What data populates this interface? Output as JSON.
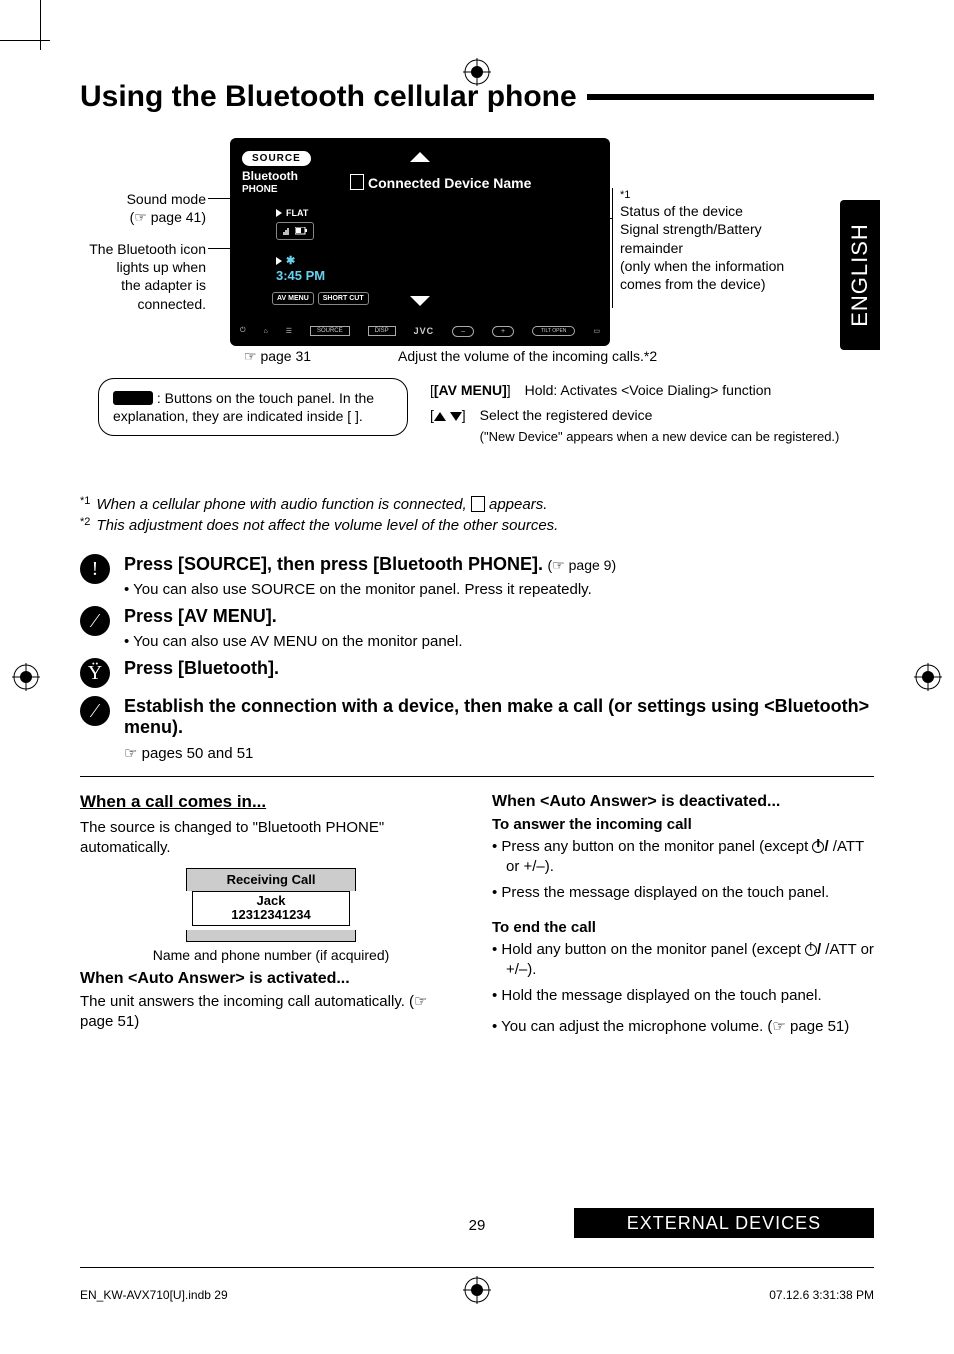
{
  "language_tab": "ENGLISH",
  "title": "Using the Bluetooth cellular phone",
  "device": {
    "source_pill": "SOURCE",
    "bt_line1": "Bluetooth",
    "bt_line2": "PHONE",
    "connected_label": "Connected Device Name",
    "flat": "FLAT",
    "bt_symbol": "✱",
    "time": "3:45 PM",
    "btn_av": "AV MENU",
    "btn_short": "SHORT CUT",
    "jvc": "JVC",
    "vol_minus": "–",
    "vol_plus": "+",
    "source_small": "SOURCE",
    "disp_small": "DISP",
    "tilt_small": "TILT OPEN"
  },
  "callouts": {
    "left1": "Sound mode",
    "left1b": "(☞ page 41)",
    "left2a": "The Bluetooth icon",
    "left2b": "lights up when",
    "left2c": "the adapter is",
    "left2d": "connected.",
    "right_star": "*1",
    "right1a": "Status of the device",
    "right1b": "Signal strength/Battery",
    "right1c": "remainder",
    "right1d": "(only when the information",
    "right1e": "comes from the device)",
    "mid_ref": "☞ page 31",
    "mid_adjust": "Adjust the volume of the incoming calls.*2"
  },
  "note_box_left": {
    "line1": ": Buttons on the touch panel. In the explanation, they are indicated inside [    ]."
  },
  "right_fn": {
    "k1": "[AV MENU]",
    "v1": "Hold: Activates <Voice Dialing> function",
    "v2": "Select the registered device",
    "v3": "(\"New Device\" appears when a new device can be registered.)"
  },
  "footnotes": {
    "f1_sup": "*1",
    "f1": "When a cellular phone with audio function is connected, ",
    "f1b": " appears.",
    "f2_sup": "*2",
    "f2": "This adjustment does not affect the volume level of the other sources."
  },
  "steps": {
    "s1_head": "Press [SOURCE], then press [Bluetooth PHONE].",
    "s1_ref": " (☞ page 9)",
    "s1_sub": "You can also use SOURCE on the monitor panel. Press it repeatedly.",
    "s2_head": "Press [AV MENU].",
    "s2_sub": "You can also use AV MENU on the monitor panel.",
    "s3_head": "Press [Bluetooth].",
    "s4_head": "Establish the connection with a device, then make a call (or settings using <Bluetooth> menu).",
    "s4_note": "☞ pages 50 and 51"
  },
  "left_col": {
    "h1": "When a call comes in...",
    "p1": "The source is changed to \"Bluetooth PHONE\" automatically.",
    "recv_title": "Receiving Call",
    "recv_name": "Jack",
    "recv_num": "12312341234",
    "recv_cap": "Name and phone number (if acquired)",
    "h2": "When <Auto Answer> is activated...",
    "p2a": "The unit answers the incoming call automatically.",
    "p2b": "(☞ page 51)"
  },
  "right_col": {
    "h1": "When <Auto Answer> is deactivated...",
    "h2": "To answer the incoming call",
    "li1a": "Press any button on the monitor panel (except ",
    "li1b": " /ATT or +/–).",
    "li2": "Press the message displayed on the touch panel.",
    "h3": "To end the call",
    "li3a": "Hold any button on the monitor panel (except ",
    "li3b": " /ATT or +/–).",
    "li4": "Hold the message displayed on the touch panel.",
    "li5": "You can adjust the microphone volume. (☞ page 51)"
  },
  "page_number": "29",
  "section_footer": "EXTERNAL DEVICES",
  "footer_left": "EN_KW-AVX710[U].indb   29",
  "footer_right": "07.12.6   3:31:38 PM"
}
